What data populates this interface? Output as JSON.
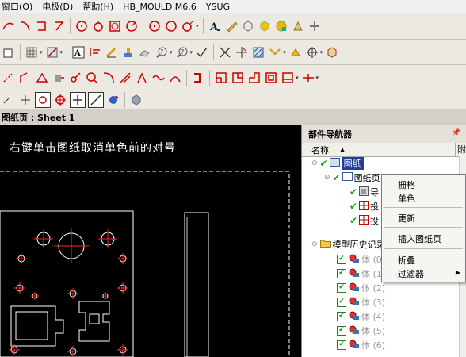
{
  "menu": {
    "items": [
      "窗口(O)",
      "电极(D)",
      "帮助(H)",
      "HB_MOULD M6.6",
      "YSUG"
    ]
  },
  "toolbar": {
    "row1": [
      "arc-icon",
      "arc2-icon",
      "dim-icon",
      "fillet-icon",
      "circle-icon",
      "circle3-icon",
      "point-icon",
      "circle-cen-icon",
      "circle-tan-icon",
      "circle-arc-icon",
      "circle-pt-icon",
      "text-a-icon",
      "pencil-icon",
      "box-icon",
      "block-icon",
      "sphere-icon",
      "cone-icon",
      "plus-icon"
    ],
    "row2": [
      "layer-icon",
      "grid-icon",
      "mesh-icon",
      "annotation-icon",
      "line-style-icon",
      "ruler-icon",
      "stamp-icon",
      "eraser-icon",
      "query-icon",
      "query2-icon",
      "check-icon",
      "x-icon",
      "cross-icon",
      "hatch-icon",
      "arrows-icon",
      "star-icon",
      "target-icon",
      "cube-icon"
    ],
    "row3": [
      "tool1-icon",
      "tool2-icon",
      "triangle-icon",
      "shape-icon",
      "curve-icon",
      "lens-icon",
      "bend-icon",
      "slash-icon",
      "arrow-up-icon",
      "wave-icon",
      "arc3-icon",
      "corner-icon",
      "square-icon",
      "notch-icon",
      "step-icon",
      "bracket-icon",
      "bracket2-icon",
      "hline-icon"
    ],
    "row4": [
      "arrow-icon",
      "plus-circle-icon",
      "target-small-icon",
      "cross-small-icon",
      "slash-small-icon",
      "globe-icon",
      "cube-gray-icon"
    ]
  },
  "tab": {
    "label": "图纸页 : Sheet 1"
  },
  "canvas": {
    "instruction": "右键单击图纸取消单色前的对号"
  },
  "navigator": {
    "title": "部件导航器",
    "col_name": "名称",
    "col_sort": "▲",
    "col_attach": "附",
    "rows": [
      {
        "label": "图纸",
        "selected": true
      },
      {
        "label": "图纸页"
      },
      {
        "label": "导"
      },
      {
        "label": "投"
      },
      {
        "label": "投"
      },
      {
        "label": "模型历史记录"
      },
      {
        "label": "体 (0)"
      },
      {
        "label": "体 (1)"
      },
      {
        "label": "体 (2)"
      },
      {
        "label": "体 (3)"
      },
      {
        "label": "体 (4)"
      },
      {
        "label": "体 (5)"
      },
      {
        "label": "体 (6)"
      }
    ]
  },
  "context_menu": {
    "items": [
      "栅格",
      "单色",
      "更新",
      "插入图纸页",
      "折叠",
      "过滤器"
    ],
    "submenu_arrow": "▶"
  },
  "colors": {
    "selection": "#1f3f9a",
    "check": "#13a313",
    "drawing_red": "#ff2222",
    "canvas": "#000000"
  }
}
